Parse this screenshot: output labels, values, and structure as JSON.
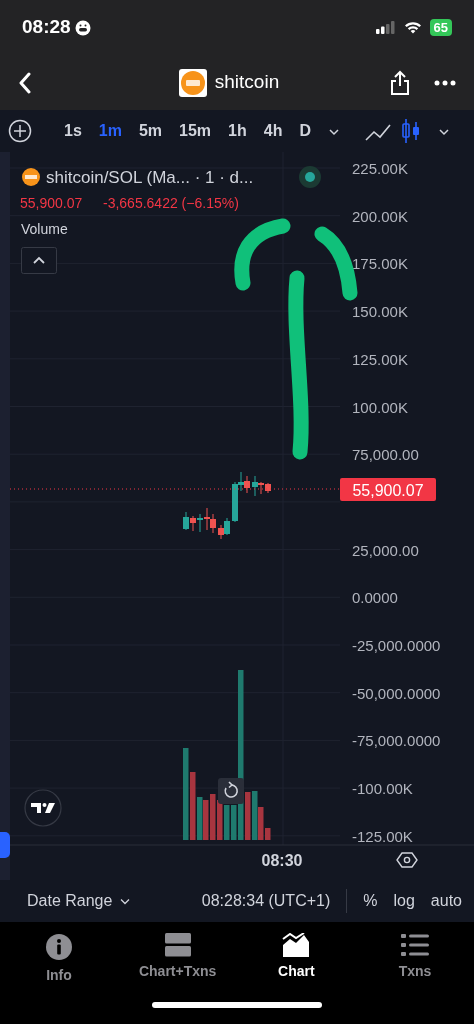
{
  "status_bar": {
    "time": "08:28",
    "battery": "65"
  },
  "header": {
    "title": "shitcoin"
  },
  "toolbar": {
    "intervals": [
      {
        "label": "1s",
        "selected": false
      },
      {
        "label": "1m",
        "selected": true
      },
      {
        "label": "5m",
        "selected": false
      },
      {
        "label": "15m",
        "selected": false
      },
      {
        "label": "1h",
        "selected": false
      },
      {
        "label": "4h",
        "selected": false
      },
      {
        "label": "D",
        "selected": false
      }
    ],
    "chart_types": [
      {
        "kind": "line",
        "selected": false
      },
      {
        "kind": "candles",
        "selected": true
      }
    ]
  },
  "chart": {
    "pair_title": "shitcoin/SOL (Ma...  · 1 · d...",
    "last_price": "55,900.07",
    "change": "-3,665.6422 (−6.15%)",
    "indicator": "Volume",
    "price_axis_upper": [
      "225.00K",
      "200.00K",
      "175.00K",
      "150.00K",
      "125.00K",
      "100.00K",
      "75,000.00"
    ],
    "price_axis_lower": [
      "25,000.00",
      "0.0000",
      "-25,000.0000",
      "-50,000.0000",
      "-75,000.0000",
      "-100.00K",
      "-125.00K"
    ],
    "price_badge": "55,900.07",
    "time_axis": [
      "08:30"
    ]
  },
  "bottom_bar": {
    "date_range": "Date Range",
    "clock": "08:28:34 (UTC+1)",
    "options": [
      "%",
      "log",
      "auto"
    ]
  },
  "tabs": [
    {
      "label": "Info",
      "kind": "info",
      "selected": false
    },
    {
      "label": "Chart+Txns",
      "kind": "split",
      "selected": false
    },
    {
      "label": "Chart",
      "kind": "chart",
      "selected": true
    },
    {
      "label": "Txns",
      "kind": "list",
      "selected": false
    }
  ]
}
